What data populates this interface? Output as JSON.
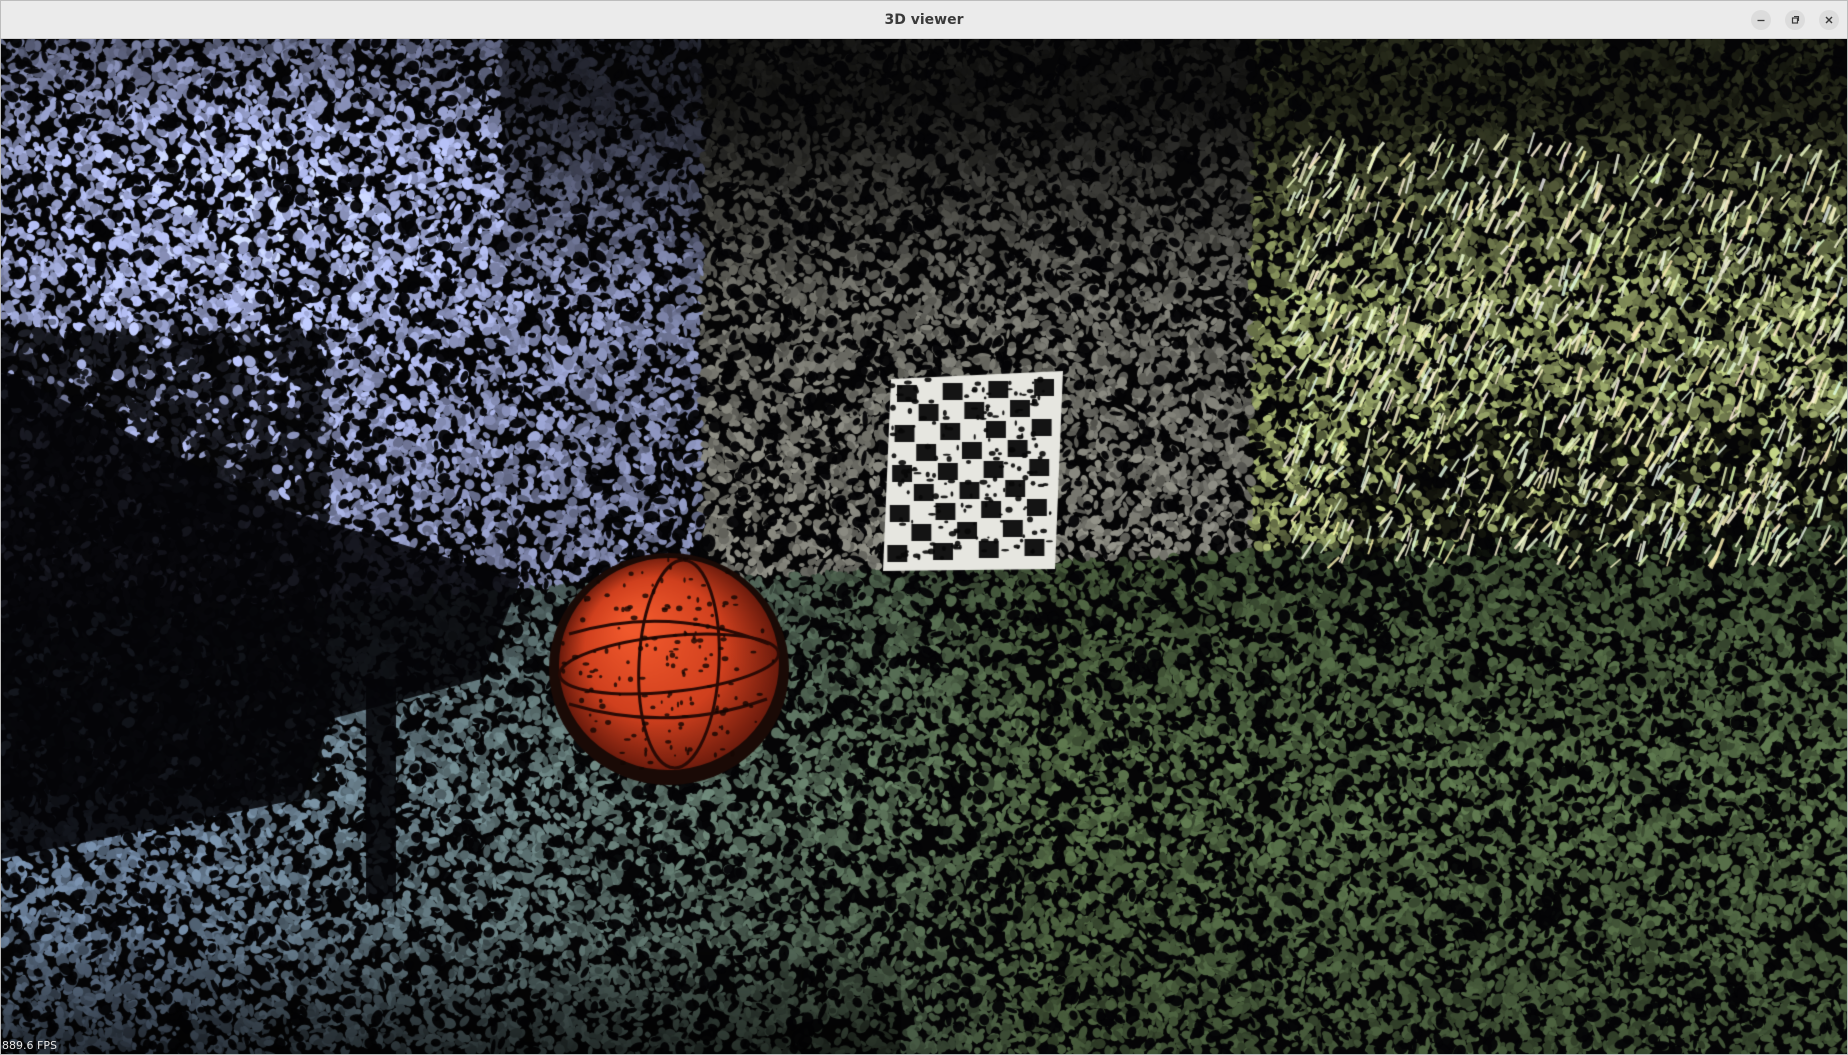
{
  "window": {
    "title": "3D viewer",
    "controls": {
      "minimize_icon": "minimize-icon",
      "maximize_icon": "maximize-icon",
      "close_icon": "close-icon"
    }
  },
  "viewport": {
    "fps_readout": "889.6 FPS",
    "scene": "point-cloud",
    "colors": {
      "wall_blue": "#aab4e6",
      "floor_green": "#7d8d62",
      "ball_orange": "#d0401e",
      "board_black": "#141414",
      "board_white": "#e6e6e0",
      "background": "#050506"
    }
  }
}
